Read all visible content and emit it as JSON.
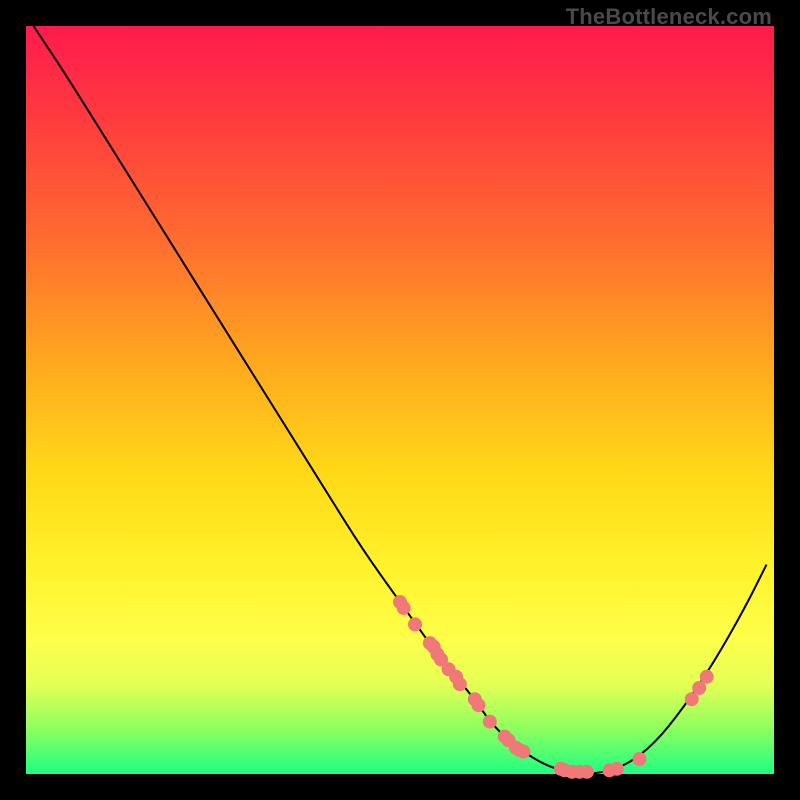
{
  "watermark": "TheBottleneck.com",
  "colors": {
    "background": "#000000",
    "curve": "#000000",
    "dots": "#f07878",
    "gradient_stops": [
      {
        "pos": 0.0,
        "color": "#ff1a4d"
      },
      {
        "pos": 0.12,
        "color": "#ff3a3f"
      },
      {
        "pos": 0.28,
        "color": "#ff6a30"
      },
      {
        "pos": 0.45,
        "color": "#ffa81e"
      },
      {
        "pos": 0.6,
        "color": "#ffd918"
      },
      {
        "pos": 0.72,
        "color": "#fff22a"
      },
      {
        "pos": 0.82,
        "color": "#feff4a"
      },
      {
        "pos": 0.88,
        "color": "#e4ff55"
      },
      {
        "pos": 0.94,
        "color": "#8cff5f"
      },
      {
        "pos": 1.0,
        "color": "#1dff82"
      }
    ]
  },
  "chart_data": {
    "type": "line",
    "title": "",
    "xlabel": "",
    "ylabel": "",
    "xlim": [
      0,
      100
    ],
    "ylim": [
      0,
      100
    ],
    "note": "Axes are unlabeled; x and y are normalized percent of plot area (0 = left/bottom, 100 = right/top). Curve is a single black valley-shaped line with scattered salmon dots along and near it.",
    "series": [
      {
        "name": "curve",
        "x": [
          1,
          5,
          10,
          15,
          20,
          25,
          30,
          35,
          40,
          45,
          50,
          55,
          60,
          62,
          65,
          68,
          70,
          73,
          76,
          80,
          84,
          88,
          92,
          96,
          99
        ],
        "y": [
          100,
          94,
          86,
          78,
          70,
          62,
          54,
          46,
          38,
          30,
          23,
          16,
          10,
          7,
          4,
          2,
          1,
          0,
          0,
          1,
          4,
          9,
          15,
          22,
          28
        ]
      }
    ],
    "points": [
      {
        "x": 50,
        "y": 23
      },
      {
        "x": 50.5,
        "y": 22.2
      },
      {
        "x": 52,
        "y": 20
      },
      {
        "x": 54,
        "y": 17.5
      },
      {
        "x": 54.5,
        "y": 17
      },
      {
        "x": 55,
        "y": 16
      },
      {
        "x": 55.5,
        "y": 15.3
      },
      {
        "x": 56.5,
        "y": 14
      },
      {
        "x": 57.5,
        "y": 13
      },
      {
        "x": 58,
        "y": 12
      },
      {
        "x": 60,
        "y": 10
      },
      {
        "x": 60.5,
        "y": 9.2
      },
      {
        "x": 62,
        "y": 7
      },
      {
        "x": 64,
        "y": 5
      },
      {
        "x": 64.5,
        "y": 4.5
      },
      {
        "x": 65.5,
        "y": 3.5
      },
      {
        "x": 66,
        "y": 3.2
      },
      {
        "x": 66.5,
        "y": 3
      },
      {
        "x": 71.5,
        "y": 0.7
      },
      {
        "x": 72,
        "y": 0.5
      },
      {
        "x": 73,
        "y": 0.3
      },
      {
        "x": 74,
        "y": 0.3
      },
      {
        "x": 75,
        "y": 0.3
      },
      {
        "x": 78,
        "y": 0.5
      },
      {
        "x": 79,
        "y": 0.7
      },
      {
        "x": 82,
        "y": 2
      },
      {
        "x": 89,
        "y": 10
      },
      {
        "x": 90,
        "y": 11.5
      },
      {
        "x": 91,
        "y": 13
      }
    ]
  }
}
